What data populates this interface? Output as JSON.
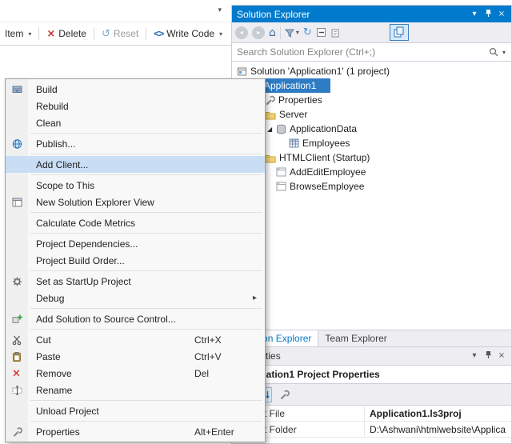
{
  "icons": {
    "chevron_down": "▾",
    "close": "×",
    "back": "◂",
    "forward": "▸",
    "home": "⌂",
    "refresh": "↻",
    "reset_arrow": "↺",
    "red_x": "×",
    "code_brackets": "<>",
    "submenu_arrow": "▸",
    "expander_expanded": "◢"
  },
  "colors": {
    "titlebar_active": "#007ACC",
    "tree_selection": "#2E7CC4",
    "menu_highlight": "#C9DEF5"
  },
  "designer_toolbar": {
    "item": "Item",
    "delete": "Delete",
    "reset": "Reset",
    "write_code": "Write Code"
  },
  "solution_explorer": {
    "title": "Solution Explorer",
    "search_placeholder": "Search Solution Explorer (Ctrl+;)",
    "tree": [
      {
        "label": "Solution 'Application1' (1 project)"
      },
      {
        "label": "Application1",
        "selected": true
      },
      {
        "label": "Properties"
      },
      {
        "label": "Server"
      },
      {
        "label": "ApplicationData"
      },
      {
        "label": "Employees"
      },
      {
        "label": "HTMLClient (Startup)"
      },
      {
        "label": "AddEditEmployee"
      },
      {
        "label": "BrowseEmployee"
      }
    ],
    "tabs": [
      {
        "label": "Solution Explorer",
        "active": true
      },
      {
        "label": "Team Explorer",
        "active": false
      }
    ]
  },
  "properties_panel": {
    "title": "Properties",
    "object_selector": "Application1 Project Properties",
    "rows": [
      {
        "name": "Project File",
        "value": "Application1.ls3proj"
      },
      {
        "name": "Project Folder",
        "value": "D:\\Ashwani\\htmlwebsite\\Applica"
      }
    ]
  },
  "context_menu": {
    "items": [
      {
        "label": "Build"
      },
      {
        "label": "Rebuild"
      },
      {
        "label": "Clean"
      },
      {
        "type": "separator"
      },
      {
        "label": "Publish..."
      },
      {
        "type": "separator"
      },
      {
        "label": "Add Client...",
        "highlighted": true
      },
      {
        "type": "separator"
      },
      {
        "label": "Scope to This"
      },
      {
        "label": "New Solution Explorer View"
      },
      {
        "type": "separator"
      },
      {
        "label": "Calculate Code Metrics"
      },
      {
        "type": "separator"
      },
      {
        "label": "Project Dependencies..."
      },
      {
        "label": "Project Build Order..."
      },
      {
        "type": "separator"
      },
      {
        "label": "Set as StartUp Project"
      },
      {
        "label": "Debug",
        "submenu": true
      },
      {
        "type": "separator"
      },
      {
        "label": "Add Solution to Source Control..."
      },
      {
        "type": "separator"
      },
      {
        "label": "Cut",
        "shortcut": "Ctrl+X"
      },
      {
        "label": "Paste",
        "shortcut": "Ctrl+V"
      },
      {
        "label": "Remove",
        "shortcut": "Del"
      },
      {
        "label": "Rename"
      },
      {
        "type": "separator"
      },
      {
        "label": "Unload Project"
      },
      {
        "type": "separator"
      },
      {
        "label": "Properties",
        "shortcut": "Alt+Enter"
      }
    ]
  }
}
